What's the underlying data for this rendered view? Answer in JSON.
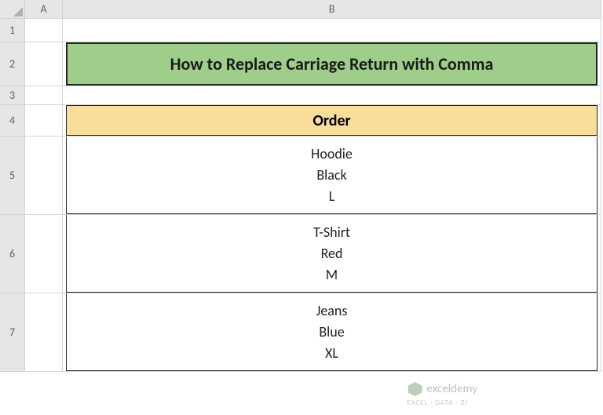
{
  "columns": {
    "a": "A",
    "b": "B"
  },
  "rows": {
    "r1": "1",
    "r2": "2",
    "r3": "3",
    "r4": "4",
    "r5": "5",
    "r6": "6",
    "r7": "7"
  },
  "title": "How to Replace Carriage Return with Comma",
  "table": {
    "header": "Order",
    "cells": [
      {
        "line1": "Hoodie",
        "line2": "Black",
        "line3": "L"
      },
      {
        "line1": "T-Shirt",
        "line2": "Red",
        "line3": "M"
      },
      {
        "line1": "Jeans",
        "line2": "Blue",
        "line3": "XL"
      }
    ]
  },
  "watermark": {
    "text": "exceldemy",
    "sub": "EXCEL · DATA · BI"
  }
}
